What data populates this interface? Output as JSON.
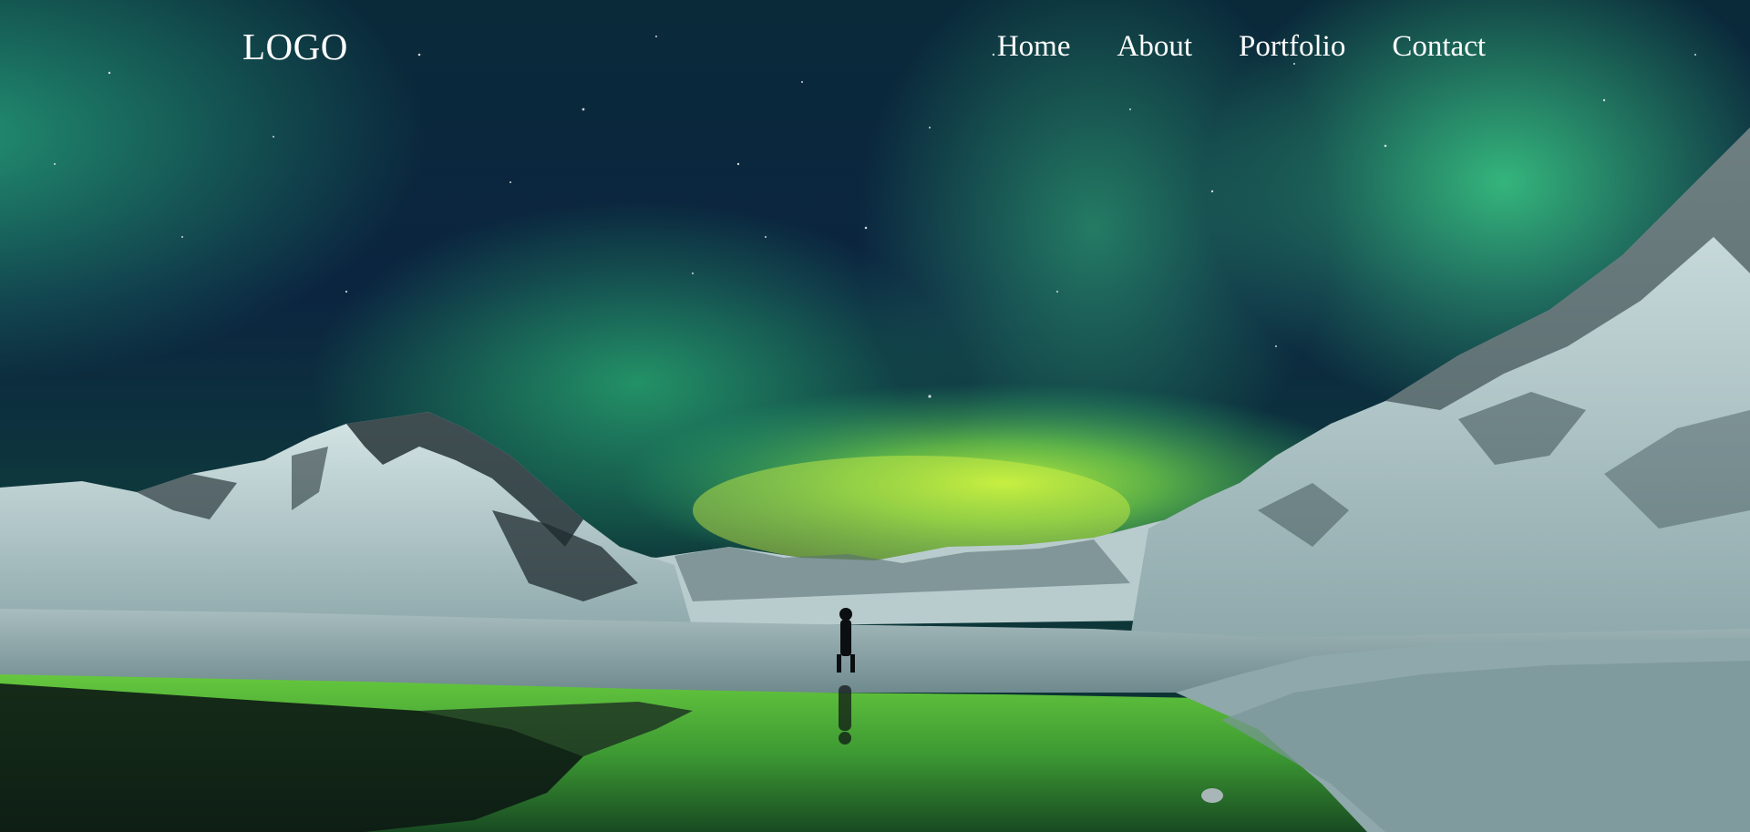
{
  "header": {
    "logo": "LOGO",
    "nav": [
      {
        "label": "Home"
      },
      {
        "label": "About"
      },
      {
        "label": "Portfolio"
      },
      {
        "label": "Contact"
      }
    ]
  },
  "hero": {
    "image": "aurora-borealis-over-snowy-mountains-and-lake-photo",
    "colors": {
      "sky": "#07192e",
      "aurora": "#2ec27a",
      "aurora_glow": "#b8f03c",
      "text": "#ffffff"
    }
  }
}
